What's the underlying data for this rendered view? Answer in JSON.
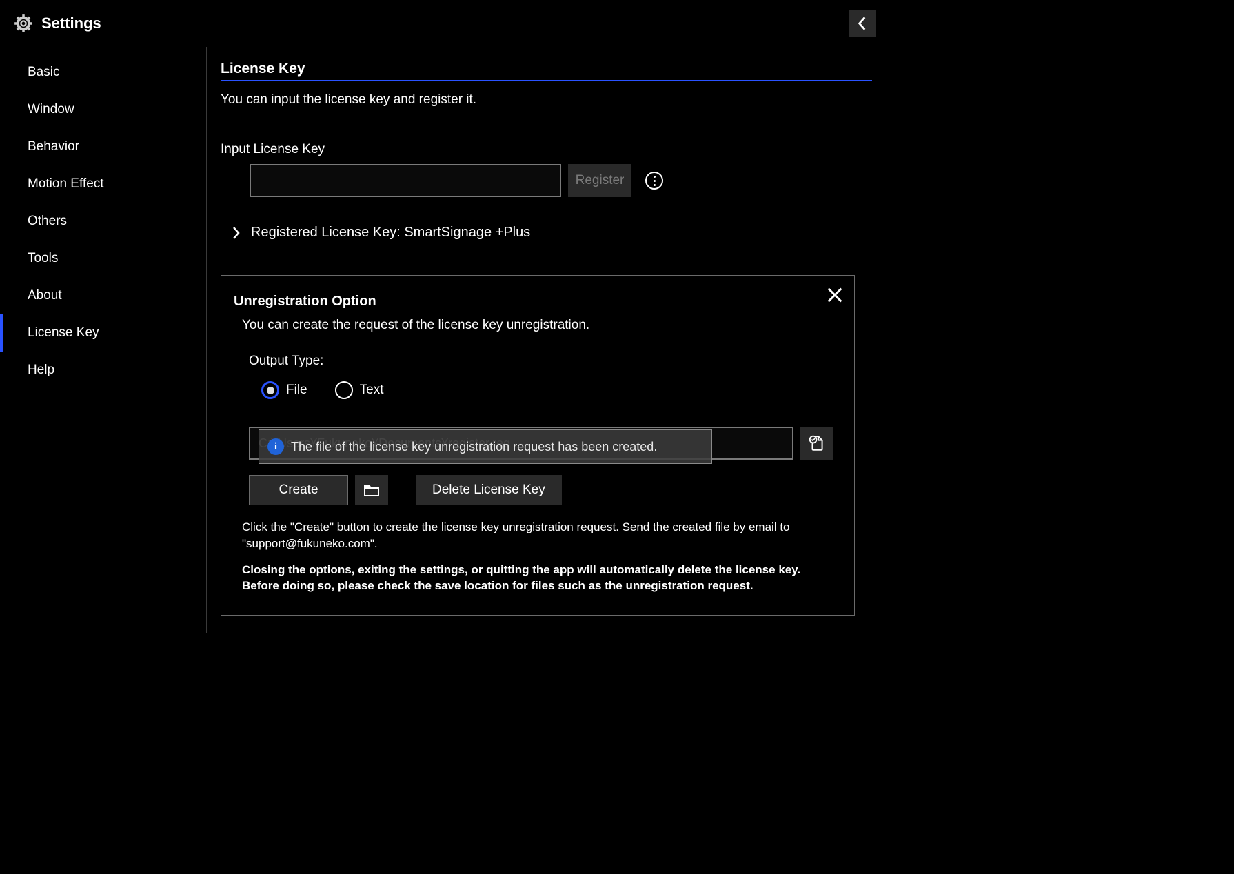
{
  "header": {
    "title": "Settings"
  },
  "sidebar": {
    "items": [
      {
        "label": "Basic"
      },
      {
        "label": "Window"
      },
      {
        "label": "Behavior"
      },
      {
        "label": "Motion Effect"
      },
      {
        "label": "Others"
      },
      {
        "label": "Tools"
      },
      {
        "label": "About"
      },
      {
        "label": "License Key"
      },
      {
        "label": "Help"
      }
    ]
  },
  "main": {
    "section_title": "License Key",
    "section_description": "You can input the license key and register it.",
    "input_label": "Input License Key",
    "input_value": "",
    "register_button": "Register",
    "registered_key_text": "Registered License Key: SmartSignage +Plus"
  },
  "panel": {
    "title": "Unregistration Option",
    "description": "You can create the request of the license key unregistration.",
    "output_type_label": "Output Type:",
    "radio_file": "File",
    "radio_text": "Text",
    "file_path": "C:¥Users¥Fukuneko¥Documents¥register.reg",
    "toast_message": "The file of the license key unregistration request has been created.",
    "create_button": "Create",
    "delete_button": "Delete License Key",
    "help_text": "Click the \"Create\" button to create the license key unregistration request. Send the created file by email to \"support@fukuneko.com\".",
    "warning_text": "Closing the options, exiting the settings, or quitting the app will automatically delete the license key. Before doing so, please check the save location for files such as the unregistration request."
  }
}
